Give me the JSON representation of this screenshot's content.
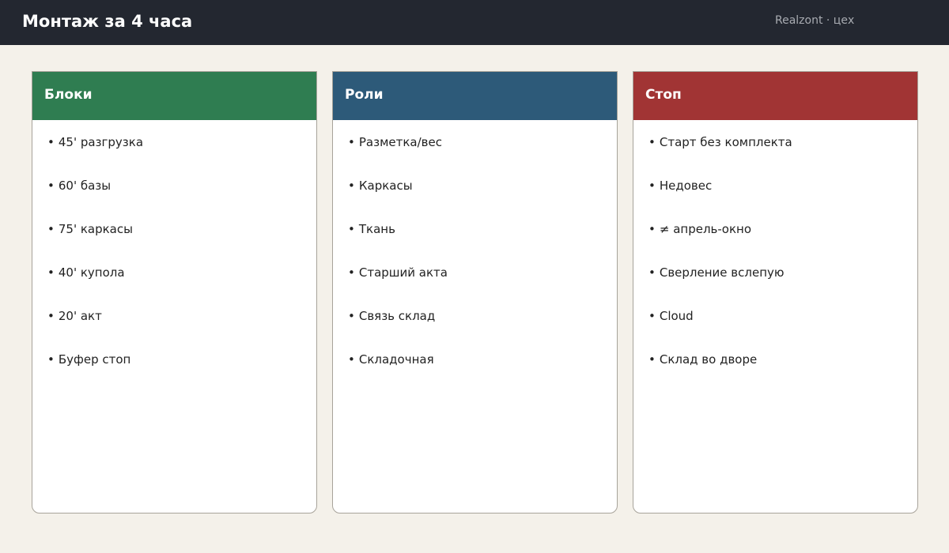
{
  "header": {
    "title": "Монтаж за 4 часа",
    "subtitle": "Realzont · цех"
  },
  "colors": {
    "header_background": "#232730",
    "page_background": "#f4f1ea",
    "blocks_accent": "#2f7d51",
    "roles_accent": "#2d5a79",
    "stops_accent": "#a13434"
  },
  "columns": [
    {
      "title": "Блоки",
      "items": [
        "45' разгрузка",
        "60' базы",
        "75' каркасы",
        "40' купола",
        "20' акт",
        "Буфер стоп"
      ]
    },
    {
      "title": "Роли",
      "items": [
        "Разметка/вес",
        "Каркасы",
        "Ткань",
        "Старший акта",
        "Связь склад",
        "Складочная"
      ]
    },
    {
      "title": "Стоп",
      "items": [
        "Старт без комплекта",
        "Недовес",
        "≠ апрель-окно",
        "Сверление вслепую",
        "Cloud",
        "Склад во дворе"
      ]
    }
  ]
}
